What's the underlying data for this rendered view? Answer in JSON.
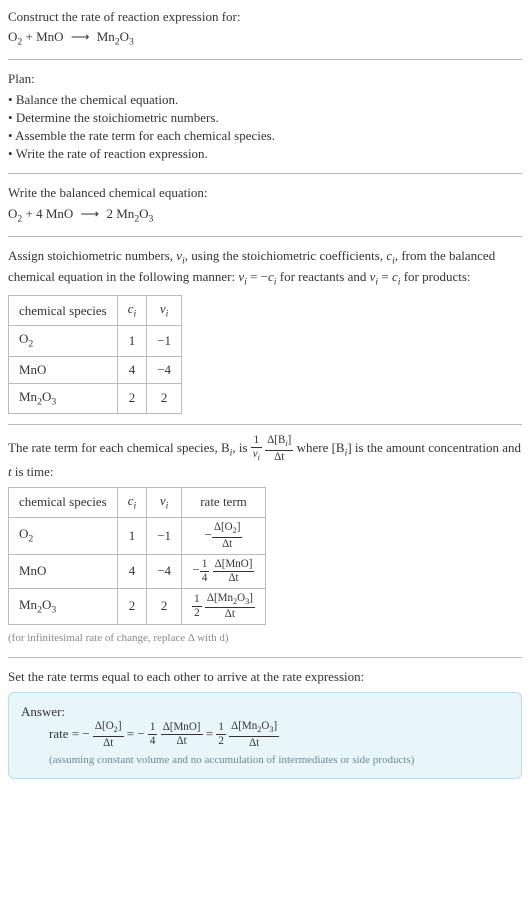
{
  "header": {
    "prompt": "Construct the rate of reaction expression for:",
    "equation_lhs1": "O",
    "equation_lhs1_sub": "2",
    "plus1": " + ",
    "equation_lhs2": "MnO",
    "arrow": "⟶",
    "equation_rhs": "Mn",
    "equation_rhs_sub1": "2",
    "equation_rhs_mid": "O",
    "equation_rhs_sub2": "3"
  },
  "plan": {
    "title": "Plan:",
    "items": [
      "Balance the chemical equation.",
      "Determine the stoichiometric numbers.",
      "Assemble the rate term for each chemical species.",
      "Write the rate of reaction expression."
    ]
  },
  "balanced": {
    "title": "Write the balanced chemical equation:",
    "o2": "O",
    "o2_sub": "2",
    "plus": " + 4 MnO ",
    "arrow": "⟶",
    "rhs_coeff": " 2 Mn",
    "rhs_sub1": "2",
    "rhs_mid": "O",
    "rhs_sub2": "3"
  },
  "stoich": {
    "intro_a": "Assign stoichiometric numbers, ",
    "nu_i": "ν",
    "nu_i_sub": "i",
    "intro_b": ", using the stoichiometric coefficients, ",
    "c_i": "c",
    "c_i_sub": "i",
    "intro_c": ", from the balanced chemical equation in the following manner: ",
    "rel1_lhs": "ν",
    "rel1_lhs_sub": "i",
    "rel1_eq": " = −",
    "rel1_rhs": "c",
    "rel1_rhs_sub": "i",
    "rel1_tail": " for reactants and ",
    "rel2_lhs": "ν",
    "rel2_lhs_sub": "i",
    "rel2_eq": " = ",
    "rel2_rhs": "c",
    "rel2_rhs_sub": "i",
    "rel2_tail": " for products:",
    "table": {
      "h1": "chemical species",
      "h2": "c",
      "h2_sub": "i",
      "h3": "ν",
      "h3_sub": "i",
      "rows": [
        {
          "name_a": "O",
          "name_sub": "2",
          "name_b": "",
          "name_sub2": "",
          "c": "1",
          "nu": "−1"
        },
        {
          "name_a": "MnO",
          "name_sub": "",
          "name_b": "",
          "name_sub2": "",
          "c": "4",
          "nu": "−4"
        },
        {
          "name_a": "Mn",
          "name_sub": "2",
          "name_b": "O",
          "name_sub2": "3",
          "c": "2",
          "nu": "2"
        }
      ]
    }
  },
  "rateterm": {
    "intro_a": "The rate term for each chemical species, B",
    "intro_a_sub": "i",
    "intro_b": ", is ",
    "frac1_num": "1",
    "frac1_den_a": "ν",
    "frac1_den_sub": "i",
    "frac2_num_a": "Δ[B",
    "frac2_num_sub": "i",
    "frac2_num_b": "]",
    "frac2_den": "Δt",
    "intro_c": " where [B",
    "intro_c_sub": "i",
    "intro_d": "] is the amount concentration and ",
    "t_var": "t",
    "intro_e": " is time:",
    "table": {
      "h1": "chemical species",
      "h2": "c",
      "h2_sub": "i",
      "h3": "ν",
      "h3_sub": "i",
      "h4": "rate term",
      "rows": [
        {
          "name_a": "O",
          "name_sub": "2",
          "name_b": "",
          "name_sub2": "",
          "c": "1",
          "nu": "−1",
          "rate_prefix": "−",
          "rate_coef_num": "",
          "rate_coef_den": "",
          "rate_num_a": "Δ[O",
          "rate_num_sub": "2",
          "rate_num_b": "]",
          "rate_den": "Δt"
        },
        {
          "name_a": "MnO",
          "name_sub": "",
          "name_b": "",
          "name_sub2": "",
          "c": "4",
          "nu": "−4",
          "rate_prefix": "−",
          "rate_coef_num": "1",
          "rate_coef_den": "4",
          "rate_num_a": "Δ[MnO",
          "rate_num_sub": "",
          "rate_num_b": "]",
          "rate_den": "Δt"
        },
        {
          "name_a": "Mn",
          "name_sub": "2",
          "name_b": "O",
          "name_sub2": "3",
          "c": "2",
          "nu": "2",
          "rate_prefix": "",
          "rate_coef_num": "1",
          "rate_coef_den": "2",
          "rate_num_a": "Δ[Mn",
          "rate_num_sub": "2",
          "rate_num_b": "O",
          "rate_num_sub2": "3",
          "rate_num_c": "]",
          "rate_den": "Δt"
        }
      ]
    },
    "footnote": "(for infinitesimal rate of change, replace Δ with d)"
  },
  "final": {
    "intro": "Set the rate terms equal to each other to arrive at the rate expression:",
    "answer_label": "Answer:",
    "rate_word": "rate = −",
    "t1_num_a": "Δ[O",
    "t1_num_sub": "2",
    "t1_num_b": "]",
    "t1_den": "Δt",
    "eq2": " = −",
    "c2_num": "1",
    "c2_den": "4",
    "t2_num": "Δ[MnO]",
    "t2_den": "Δt",
    "eq3": " = ",
    "c3_num": "1",
    "c3_den": "2",
    "t3_num_a": "Δ[Mn",
    "t3_num_sub1": "2",
    "t3_num_b": "O",
    "t3_num_sub2": "3",
    "t3_num_c": "]",
    "t3_den": "Δt",
    "note": "(assuming constant volume and no accumulation of intermediates or side products)"
  }
}
